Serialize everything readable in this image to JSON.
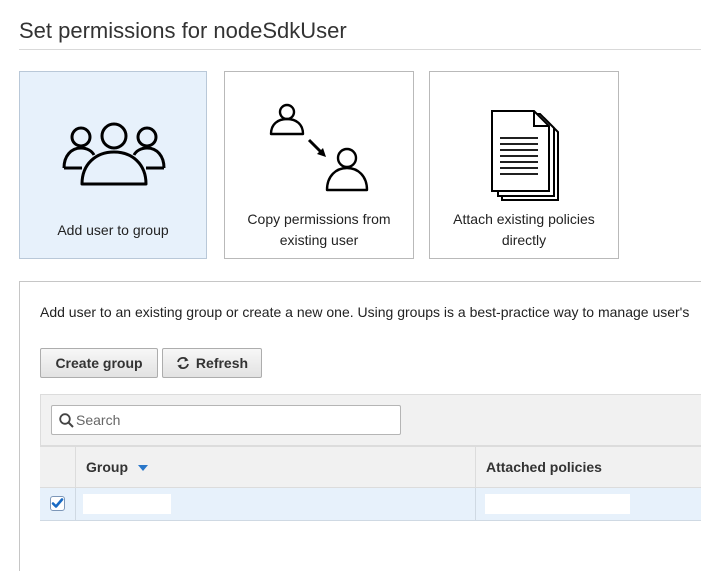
{
  "page": {
    "title": "Set permissions for nodeSdkUser"
  },
  "options": [
    {
      "label": "Add user to group",
      "selected": true,
      "icon": "users-group-icon"
    },
    {
      "label": "Copy permissions from existing user",
      "selected": false,
      "icon": "copy-user-icon"
    },
    {
      "label": "Attach existing policies directly",
      "selected": false,
      "icon": "policy-document-icon"
    }
  ],
  "panel": {
    "description": "Add user to an existing group or create a new one. Using groups is a best-practice way to manage user's",
    "create_group_label": "Create group",
    "refresh_label": "Refresh",
    "search_placeholder": "Search",
    "columns": [
      "Group",
      "Attached policies"
    ],
    "sort_column": "Group",
    "rows": [
      {
        "checked": true,
        "group": "",
        "attached_policies": ""
      }
    ]
  },
  "colors": {
    "selected_card_bg": "#e7f1fb",
    "checkbox_blue": "#1a6bc4",
    "sort_arrow": "#2a77c9"
  }
}
